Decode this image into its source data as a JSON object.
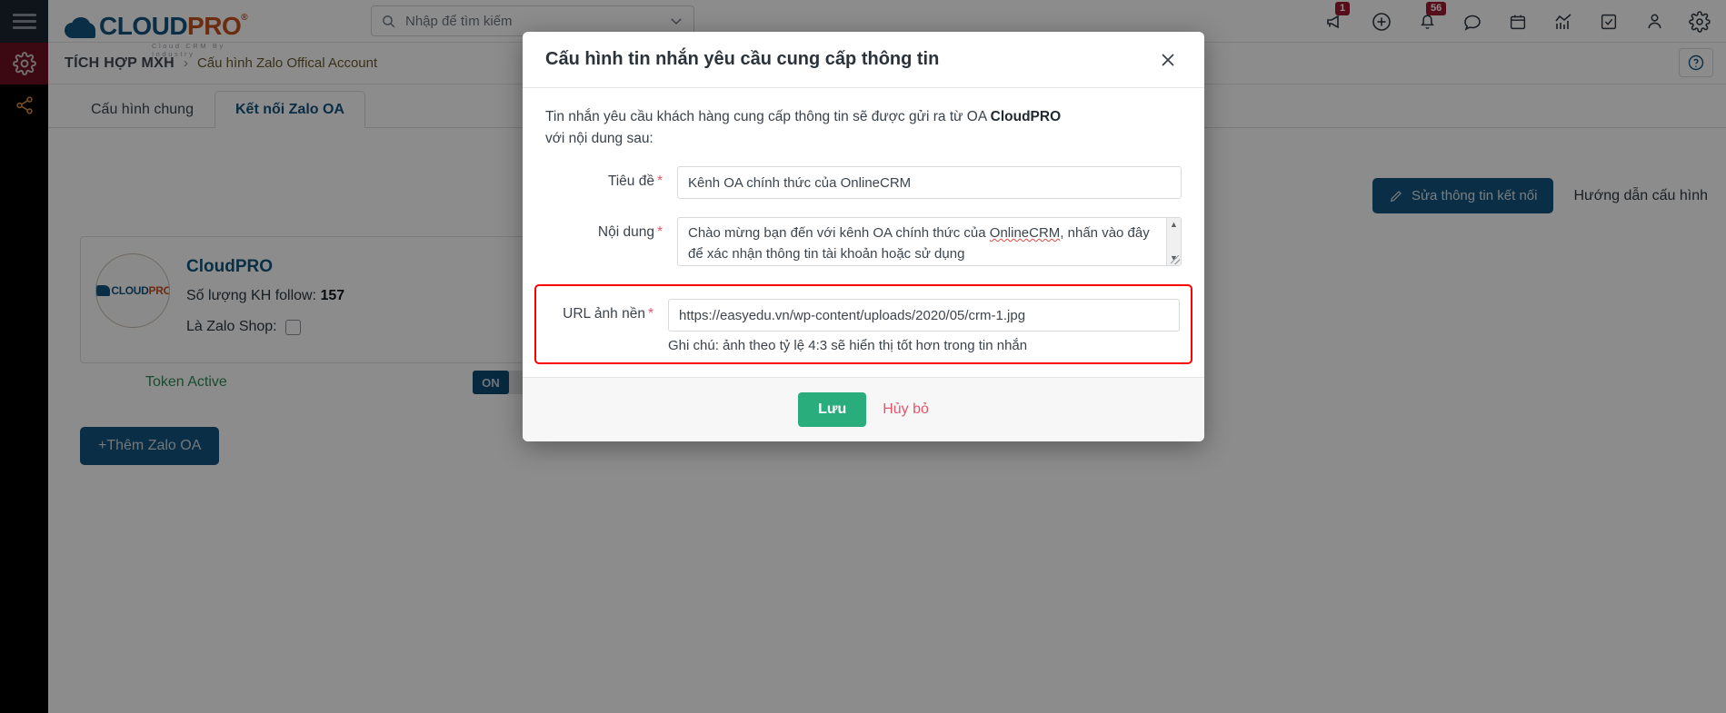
{
  "brand": {
    "name_cloud": "CLOUD",
    "name_pro": "PRO",
    "registered": "®",
    "tagline": "Cloud CRM By Industry"
  },
  "topbar": {
    "search": {
      "placeholder": "Nhập để tìm kiếm",
      "value": ""
    },
    "icons": [
      {
        "name": "megaphone-icon",
        "badge": "1"
      },
      {
        "name": "plus-circle-icon",
        "badge": ""
      },
      {
        "name": "bell-icon",
        "badge": "56"
      },
      {
        "name": "chat-icon",
        "badge": ""
      },
      {
        "name": "calendar-icon",
        "badge": ""
      },
      {
        "name": "chart-icon",
        "badge": ""
      },
      {
        "name": "checkbox-icon",
        "badge": ""
      },
      {
        "name": "user-icon",
        "badge": ""
      },
      {
        "name": "gear-icon",
        "badge": ""
      }
    ]
  },
  "rail": {
    "menu_icon": "hamburger-icon",
    "items": [
      {
        "name": "gear-icon",
        "active": true
      },
      {
        "name": "share-nodes-icon",
        "active": false
      }
    ]
  },
  "breadcrumb": {
    "root": "TÍCH HỢP MXH",
    "separator": "›",
    "leaf": "Cấu hình Zalo Offical Account",
    "help_icon": "question-circle-icon"
  },
  "tabs": [
    {
      "label": "Cấu hình chung",
      "active": false
    },
    {
      "label": "Kết nối Zalo OA",
      "active": true
    }
  ],
  "actions": {
    "edit_connection": "Sửa thông tin kết nối",
    "edit_icon": "pencil-icon",
    "guide_link": "Hướng dẫn cấu hình"
  },
  "oa_card": {
    "name": "CloudPRO",
    "follow_label": "Số lượng KH follow:",
    "follow_count": "157",
    "shop_label": "Là Zalo Shop:",
    "shop_checked": false,
    "token_status": "Token Active",
    "token_status_color": "#2e8b57",
    "toggle_on_label": "ON",
    "toggle_on_color": "#0d4b74"
  },
  "add_button": "+Thêm Zalo OA",
  "modal": {
    "title": "Cấu hình tin nhắn yêu cầu cung cấp thông tin",
    "close_icon": "close-icon",
    "intro_before": "Tin nhắn yêu cầu khách hàng cung cấp thông tin sẽ được gửi ra từ OA ",
    "intro_bold": "CloudPRO",
    "intro_after": " với nội dung sau:",
    "fields": [
      {
        "label": "Tiêu đề",
        "required": "*",
        "value": "Kênh OA chính thức của OnlineCRM"
      },
      {
        "label": "Nội dung",
        "required": "*",
        "value_line1_a": "Chào mừng bạn đến với kênh OA chính thức của ",
        "value_line1_spell": "OnlineCRM",
        "value_line1_b": ",",
        "value_line2": "nhấn vào đây để xác nhận thông tin tài khoản hoặc sử dụng",
        "scroll_up": "▲",
        "scroll_down": "▼"
      },
      {
        "label": "URL ảnh nền",
        "required": "*",
        "value": "https://easyedu.vn/wp-content/uploads/2020/05/crm-1.jpg",
        "note": "Ghi chú: ảnh theo tỷ lệ 4:3 sẽ hiển thị tốt hơn trong tin nhắn",
        "highlight_color": "#ff0000"
      }
    ],
    "save_label": "Lưu",
    "save_color": "#2aad7c",
    "cancel_label": "Hủy bỏ",
    "cancel_color": "#e4556b"
  }
}
